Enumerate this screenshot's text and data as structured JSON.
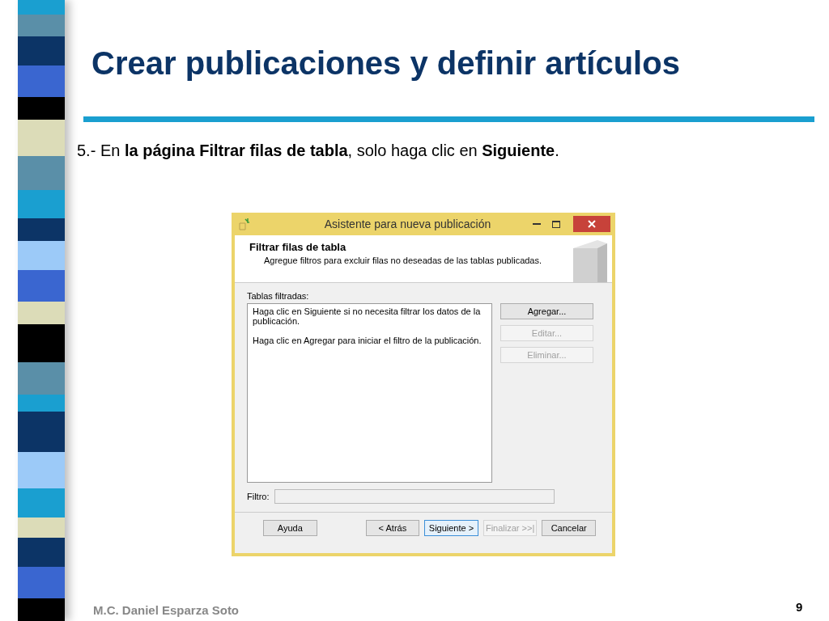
{
  "slide": {
    "title": "Crear publicaciones y definir artículos",
    "instruction": "5.- En **la página Filtrar filas de tabla**, solo haga clic en **Siguiente**.",
    "footer": "M.C. Daniel Esparza Soto",
    "page_number": "9"
  },
  "dialog": {
    "title": "Asistente para nueva publicación",
    "header": {
      "title": "Filtrar filas de tabla",
      "subtitle": "Agregue filtros para excluir filas no deseadas de las tablas publicadas."
    },
    "list_label": "Tablas filtradas:",
    "list_lines": [
      "Haga clic en Siguiente si no necesita filtrar los datos de la publicación.",
      "Haga clic en Agregar para iniciar el filtro de la publicación."
    ],
    "side_buttons": [
      {
        "label": "Agregar...",
        "disabled": false
      },
      {
        "label": "Editar...",
        "disabled": true
      },
      {
        "label": "Eliminar...",
        "disabled": true
      }
    ],
    "filter": {
      "label": "Filtro:"
    },
    "footer_buttons": [
      {
        "label": "Ayuda",
        "disabled": false,
        "focused": false
      },
      {
        "label": "< Atrás",
        "disabled": false,
        "focused": false
      },
      {
        "label": "Siguiente >",
        "disabled": false,
        "focused": true
      },
      {
        "label": "Finalizar >>|",
        "disabled": true,
        "focused": false
      },
      {
        "label": "Cancelar",
        "disabled": false,
        "focused": false
      }
    ]
  }
}
